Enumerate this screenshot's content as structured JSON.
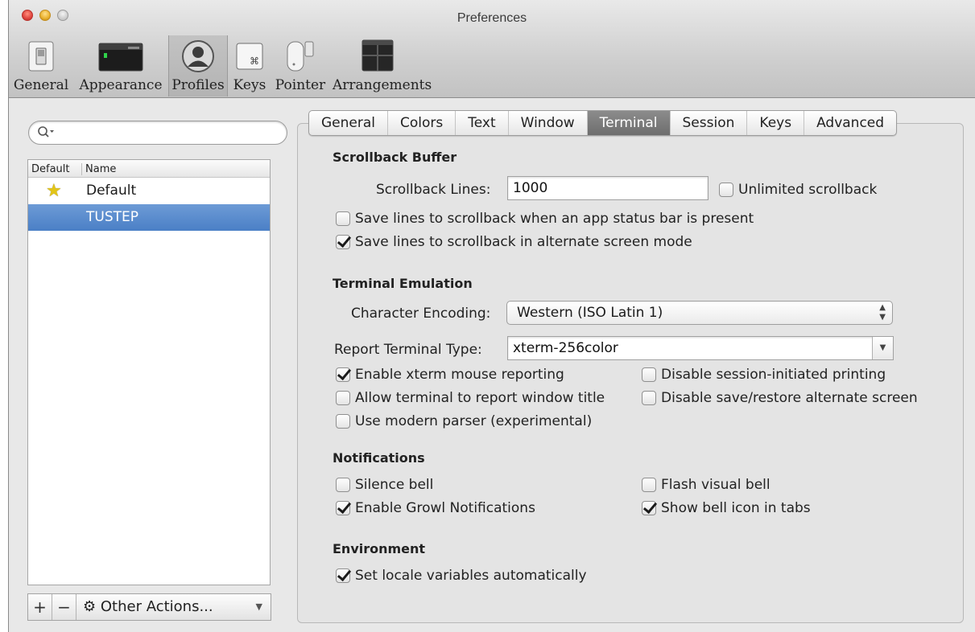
{
  "window": {
    "title": "Preferences"
  },
  "toolbar": {
    "items": [
      {
        "label": "General",
        "icon": "general-switch-icon"
      },
      {
        "label": "Appearance",
        "icon": "appearance-monitor-icon"
      },
      {
        "label": "Profiles",
        "icon": "profiles-person-icon",
        "selected": true
      },
      {
        "label": "Keys",
        "icon": "keys-command-icon"
      },
      {
        "label": "Pointer",
        "icon": "pointer-mouse-icon"
      },
      {
        "label": "Arrangements",
        "icon": "arrangements-windows-icon"
      }
    ]
  },
  "sidebar": {
    "search": {
      "placeholder": "",
      "icon": "search-icon"
    },
    "columns": [
      "Default",
      "Name"
    ],
    "profiles": [
      {
        "name": "Default",
        "is_default": true,
        "selected": false
      },
      {
        "name": "TUSTEP",
        "is_default": false,
        "selected": true
      }
    ],
    "add_label": "+",
    "remove_label": "−",
    "other_actions_label": "Other Actions..."
  },
  "tabs": [
    "General",
    "Colors",
    "Text",
    "Window",
    "Terminal",
    "Session",
    "Keys",
    "Advanced"
  ],
  "selected_tab": "Terminal",
  "terminal": {
    "scrollback": {
      "title": "Scrollback Buffer",
      "lines_label": "Scrollback Lines:",
      "lines_value": "1000",
      "unlimited_label": "Unlimited scrollback",
      "unlimited_checked": false,
      "save_status_bar_label": "Save lines to scrollback when an app status bar is present",
      "save_status_bar_checked": false,
      "save_alternate_label": "Save lines to scrollback in alternate screen mode",
      "save_alternate_checked": true
    },
    "emulation": {
      "title": "Terminal Emulation",
      "encoding_label": "Character Encoding:",
      "encoding_value": "Western (ISO Latin 1)",
      "report_type_label": "Report Terminal Type:",
      "report_type_value": "xterm-256color",
      "mouse_reporting_label": "Enable xterm mouse reporting",
      "mouse_reporting_checked": true,
      "window_title_label": "Allow terminal to report window title",
      "window_title_checked": false,
      "modern_parser_label": "Use modern parser (experimental)",
      "modern_parser_checked": false,
      "disable_printing_label": "Disable session-initiated printing",
      "disable_printing_checked": false,
      "disable_alt_screen_label": "Disable save/restore alternate screen",
      "disable_alt_screen_checked": false
    },
    "notifications": {
      "title": "Notifications",
      "silence_bell_label": "Silence bell",
      "silence_bell_checked": false,
      "growl_label": "Enable Growl Notifications",
      "growl_checked": true,
      "flash_bell_label": "Flash visual bell",
      "flash_bell_checked": false,
      "bell_icon_label": "Show bell icon in tabs",
      "bell_icon_checked": true
    },
    "environment": {
      "title": "Environment",
      "locale_label": "Set locale variables automatically",
      "locale_checked": true
    }
  }
}
